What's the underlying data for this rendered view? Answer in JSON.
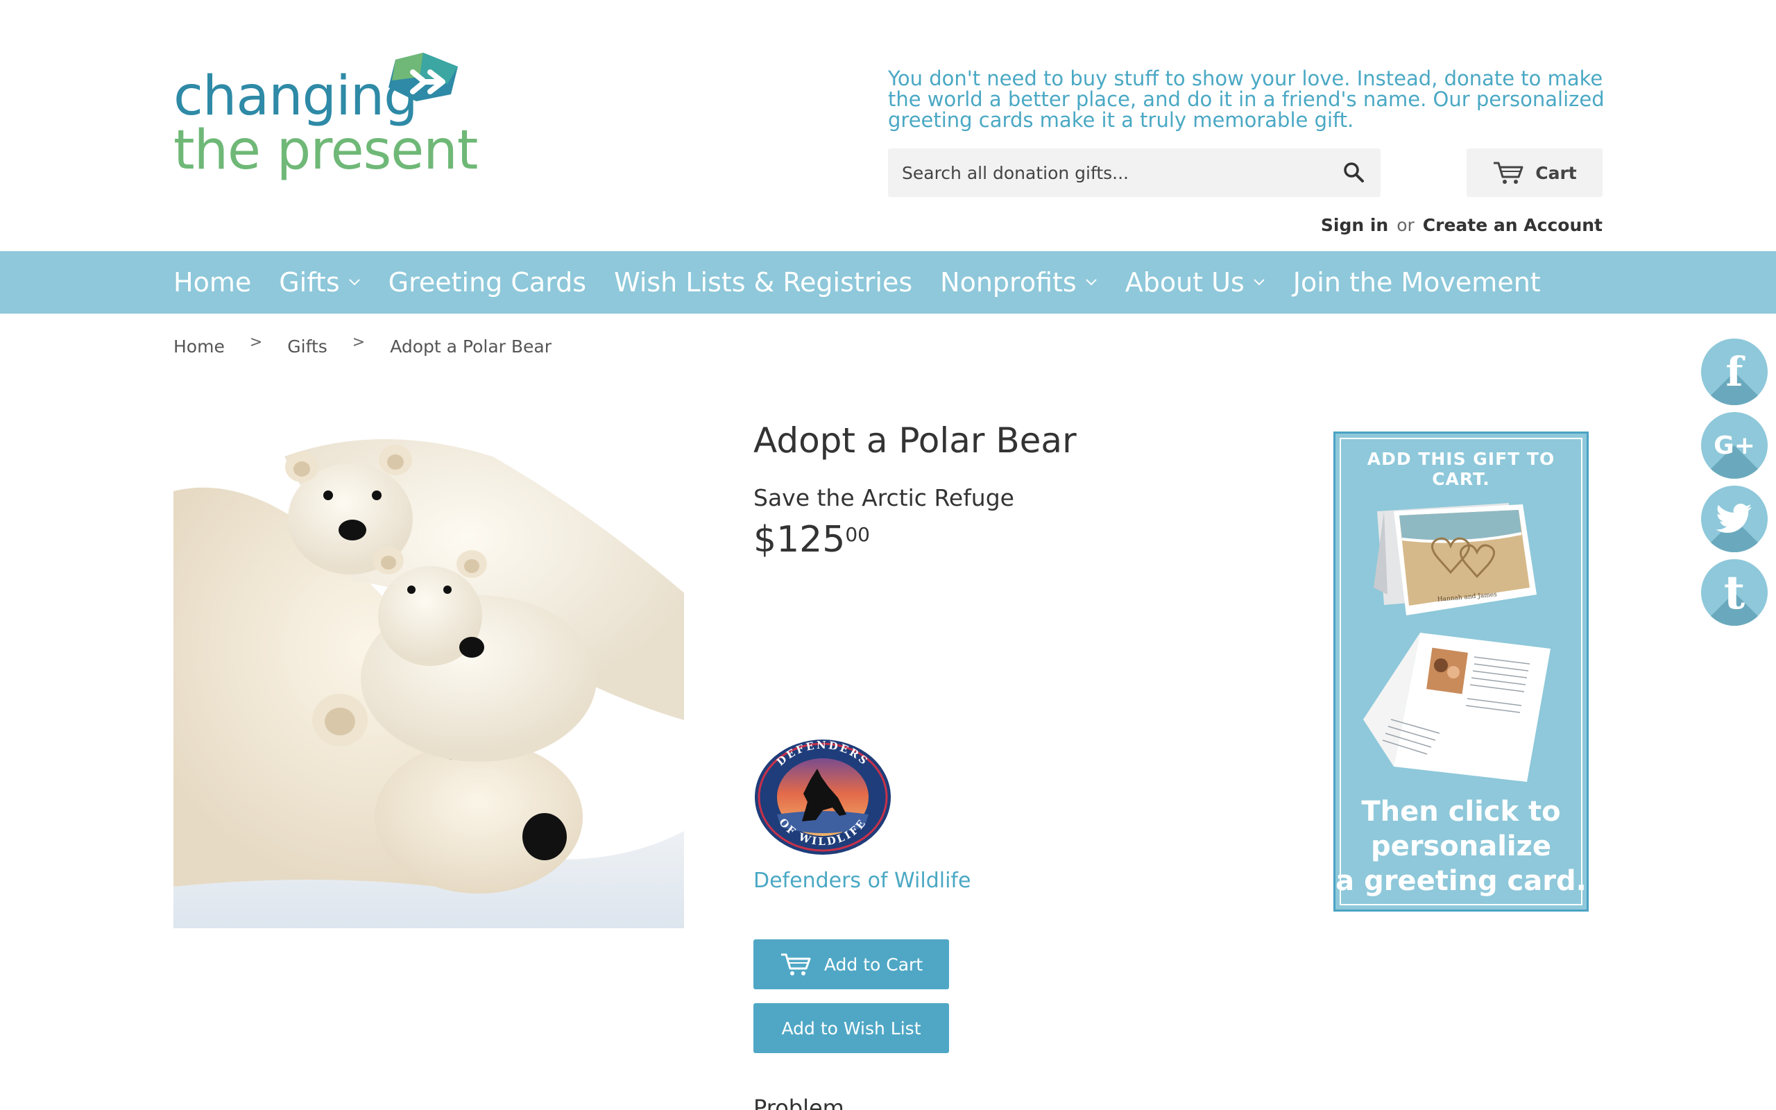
{
  "brand": {
    "line1": "changing",
    "line2": "the present",
    "colors": {
      "primary": "#2e8aa6",
      "secondary": "#6fb877",
      "accent": "#4aa8c4"
    }
  },
  "header": {
    "tagline": "You don't need to buy stuff to show your love. Instead, donate to make the world a better place, and do it in a friend's name. Our personalized greeting cards make it a truly memorable gift.",
    "search_placeholder": "Search all donation gifts...",
    "search_icon": "search-icon",
    "cart_label": "Cart",
    "cart_icon": "cart-icon",
    "sign_in": "Sign in",
    "or": "or",
    "create_account": "Create an Account"
  },
  "nav": {
    "items": [
      {
        "label": "Home",
        "dropdown": false
      },
      {
        "label": "Gifts",
        "dropdown": true
      },
      {
        "label": "Greeting Cards",
        "dropdown": false
      },
      {
        "label": "Wish Lists & Registries",
        "dropdown": false
      },
      {
        "label": "Nonprofits",
        "dropdown": true
      },
      {
        "label": "About Us",
        "dropdown": true
      },
      {
        "label": "Join the Movement",
        "dropdown": false
      }
    ]
  },
  "breadcrumb": {
    "items": [
      "Home",
      "Gifts",
      "Adopt a Polar Bear"
    ],
    "separator": ">"
  },
  "social": {
    "items": [
      {
        "name": "facebook-icon",
        "glyph": "f"
      },
      {
        "name": "google-plus-icon",
        "glyph": "G+"
      },
      {
        "name": "twitter-icon",
        "glyph": ""
      },
      {
        "name": "tumblr-icon",
        "glyph": "t"
      }
    ]
  },
  "product": {
    "title": "Adopt a Polar Bear",
    "subtitle": "Save the Arctic Refuge",
    "price_main": "$125",
    "price_cents": "00",
    "organization": "Defenders of Wildlife",
    "org_logo_text_top": "DEFENDERS",
    "org_logo_text_bottom": "OF WILDLIFE",
    "add_to_cart": "Add to Cart",
    "add_to_wishlist": "Add to Wish List",
    "section_heading": "Problem"
  },
  "promo": {
    "heading": "ADD THIS GIFT TO CART.",
    "card_names": "Hannah and James",
    "footer_line1": "Then click to",
    "footer_line2": "personalize",
    "footer_line3": "a greeting card."
  }
}
